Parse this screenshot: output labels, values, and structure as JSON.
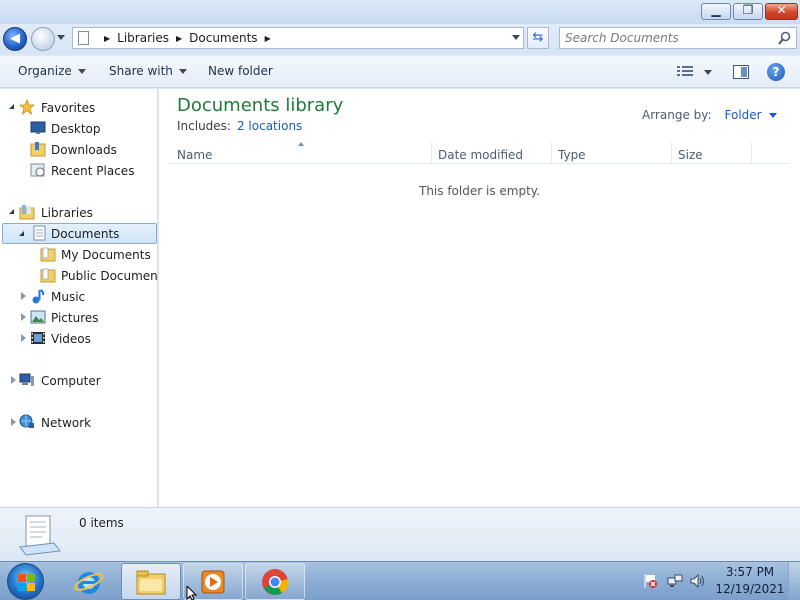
{
  "window": {
    "minimize_glyph": "▁",
    "maximize_glyph": "❐",
    "close_glyph": "✕"
  },
  "address": {
    "crumbs": [
      "Libraries",
      "Documents"
    ],
    "search_placeholder": "Search Documents"
  },
  "toolbar": {
    "organize": "Organize",
    "share_with": "Share with",
    "new_folder": "New folder",
    "help_glyph": "?"
  },
  "nav": {
    "favorites": "Favorites",
    "desktop": "Desktop",
    "downloads": "Downloads",
    "recent_places": "Recent Places",
    "libraries": "Libraries",
    "documents": "Documents",
    "my_documents": "My Documents",
    "public_documents": "Public Documents",
    "music": "Music",
    "pictures": "Pictures",
    "videos": "Videos",
    "computer": "Computer",
    "network": "Network"
  },
  "content": {
    "title": "Documents library",
    "includes_label": "Includes:",
    "includes_link": "2 locations",
    "arrange_label": "Arrange by:",
    "arrange_value": "Folder",
    "columns": [
      "Name",
      "Date modified",
      "Type",
      "Size"
    ],
    "empty_message": "This folder is empty."
  },
  "details": {
    "item_count": "0 items"
  },
  "taskbar": {
    "time": "3:57 PM",
    "date": "12/19/2021"
  },
  "colors": {
    "title_green": "#1e7b3a",
    "link_blue": "#1a5ac8"
  }
}
